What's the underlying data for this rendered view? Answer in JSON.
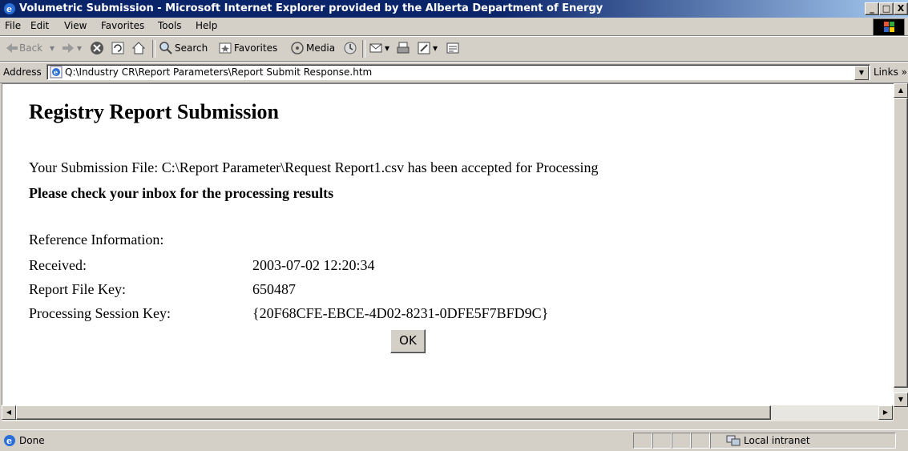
{
  "window": {
    "title": "Volumetric Submission - Microsoft Internet Explorer provided by the Alberta Department of Energy",
    "min_label": "_",
    "max_label": "□",
    "close_label": "X"
  },
  "menu": {
    "file": "File",
    "edit": "Edit",
    "view": "View",
    "favorites": "Favorites",
    "tools": "Tools",
    "help": "Help"
  },
  "toolbar": {
    "back": "Back",
    "search": "Search",
    "favorites": "Favorites",
    "media": "Media"
  },
  "address": {
    "label": "Address",
    "url": "Q:\\Industry CR\\Report Parameters\\Report Submit Response.htm",
    "links": "Links"
  },
  "page": {
    "title": "Registry Report Submission",
    "message": "Your Submission File: C:\\Report Parameter\\Request Report1.csv has been accepted for Processing",
    "instruction": "Please check your inbox for the processing results",
    "reference_heading": "Reference Information:",
    "rows": [
      {
        "label": "Received:",
        "value": "2003-07-02 12:20:34"
      },
      {
        "label": "Report File Key:",
        "value": "650487"
      },
      {
        "label": "Processing Session Key:",
        "value": "{20F68CFE-EBCE-4D02-8231-0DFE5F7BFD9C}"
      }
    ],
    "ok_label": "OK"
  },
  "status": {
    "text": "Done",
    "zone": "Local intranet"
  },
  "icons": [
    "ie-icon",
    "windows-logo-icon",
    "back-arrow-icon",
    "forward-arrow-icon",
    "stop-icon",
    "refresh-icon",
    "home-icon",
    "search-icon",
    "favorites-icon",
    "media-icon",
    "history-icon",
    "mail-icon",
    "print-icon",
    "edit-icon",
    "discuss-icon",
    "page-icon",
    "intranet-icon"
  ],
  "colors": {
    "titlebar_start": "#0a246a",
    "titlebar_end": "#a6caf0",
    "chrome": "#d4d0c8"
  }
}
